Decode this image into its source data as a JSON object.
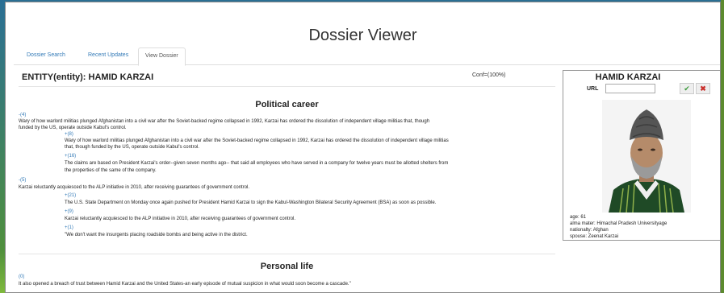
{
  "page": {
    "title": "Dossier Viewer"
  },
  "tabs": [
    {
      "label": "Dossier Search"
    },
    {
      "label": "Recent Updates"
    },
    {
      "label": "View Dossier"
    }
  ],
  "entity": {
    "heading": "ENTITY(entity): HAMID KARZAI",
    "conf": "Conf=(100%)"
  },
  "political": {
    "title": "Political career",
    "items": [
      {
        "score": "-(4)",
        "text": "Wary of how warlord militias plunged Afghanistan into a civil war after the Soviet-backed regime collapsed in 1992, Karzai has ordered the dissolution of independent village militias that, though",
        "text2": "funded by the US, operate outside Kabul's control."
      },
      {
        "score": "+(8)",
        "text": "Wary of how warlord militias plunged Afghanistan into a civil war after the Soviet-backed regime collapsed in 1992, Karzai has ordered the dissolution of independent village militias",
        "text2": "that, though funded by the US, operate outside Kabul's control."
      },
      {
        "score": "+(16)",
        "text": "The claims are based on President Karzai's order--given seven months ago-- that said all employees who have served in a company for twelve years must be allotted shelters from",
        "text2": "the properties of the same of the company."
      },
      {
        "score": "-(5)",
        "text": "Karzai reluctantly acquiesced to the ALP initiative in 2010, after receiving guarantees of government control."
      },
      {
        "score": "+(21)",
        "text": "The U.S. State Department on Monday once again pushed for President Hamid Karzai to sign the Kabul-Washington Bilateral Security Agreement (BSA) as soon as possible."
      },
      {
        "score": "+(9)",
        "text": "Karzai reluctantly acquiesced to the ALP initiative in 2010, after receiving guarantees of government control."
      },
      {
        "score": "+(1)",
        "text": "\"We don't want the insurgents placing roadside bombs and being active in the district."
      }
    ]
  },
  "personal": {
    "title": "Personal life",
    "items": [
      {
        "score": "(0)",
        "text": "It also opened a breach of trust between Hamid Karzai and the United States-an early episode of mutual suspicion in what would soon become a cascade.\""
      }
    ]
  },
  "card": {
    "name": "HAMID KARZAI",
    "url_label": "URL",
    "url_value": "",
    "ok_icon": "check-icon",
    "cancel_icon": "x-icon",
    "attributes": [
      "age: 61",
      "alma mater: Himachal Pradesh Universityage",
      "nationalty: Afghan",
      "spouse: Zeenat Karzai"
    ]
  },
  "colors": {
    "link": "#337ab7",
    "ok": "#3c9a3c",
    "cancel": "#c9302c"
  }
}
